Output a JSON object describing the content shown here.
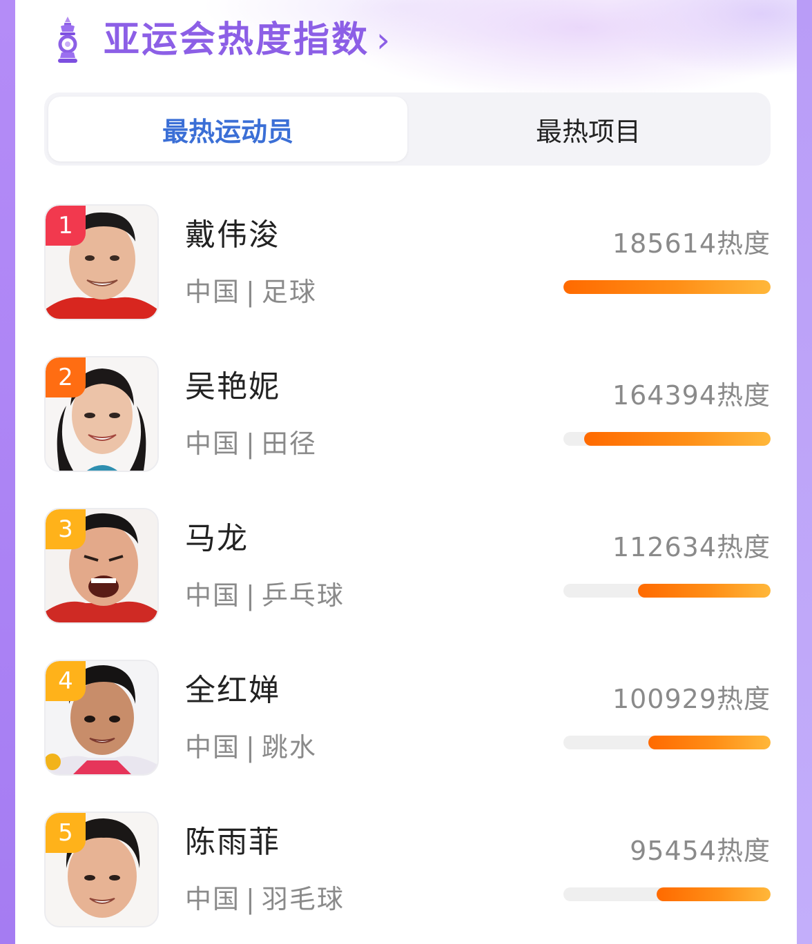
{
  "header": {
    "title": "亚运会热度指数",
    "arrow": "›",
    "logo_icon": "asian-games-torch-logo"
  },
  "tabs": [
    {
      "label": "最热运动员",
      "active": true
    },
    {
      "label": "最热项目",
      "active": false
    }
  ],
  "colors": {
    "accent": "#8c5fe6",
    "tab_active": "#3b6fd6",
    "rank_1": "#f2394e",
    "rank_2": "#ff6d12",
    "rank_3_5": "#ffb21a",
    "bar": "#ff7f0e"
  },
  "athletes": [
    {
      "rank": "1",
      "name": "戴伟浚",
      "country": "中国",
      "separator": "|",
      "sport": "足球",
      "heat": "185614热度",
      "heat_fraction": 1.0,
      "rank_color": "#f2394e"
    },
    {
      "rank": "2",
      "name": "吴艳妮",
      "country": "中国",
      "separator": "|",
      "sport": "田径",
      "heat": "164394热度",
      "heat_fraction": 0.9,
      "rank_color": "#ff6d12"
    },
    {
      "rank": "3",
      "name": "马龙",
      "country": "中国",
      "separator": "|",
      "sport": "乒乓球",
      "heat": "112634热度",
      "heat_fraction": 0.64,
      "rank_color": "#ffb21a"
    },
    {
      "rank": "4",
      "name": "全红婵",
      "country": "中国",
      "separator": "|",
      "sport": "跳水",
      "heat": "100929热度",
      "heat_fraction": 0.59,
      "rank_color": "#ffb21a"
    },
    {
      "rank": "5",
      "name": "陈雨菲",
      "country": "中国",
      "separator": "|",
      "sport": "羽毛球",
      "heat": "95454热度",
      "heat_fraction": 0.55,
      "rank_color": "#ffb21a"
    }
  ]
}
